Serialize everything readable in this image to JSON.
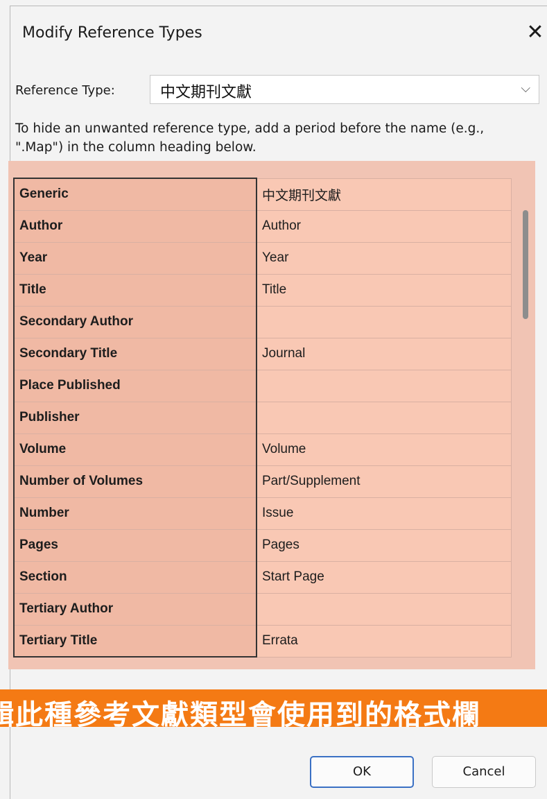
{
  "window": {
    "title": "Modify Reference Types",
    "close_glyph": "✕"
  },
  "reference_type": {
    "label": "Reference Type:",
    "selected": "中文期刊文獻",
    "chevron": "⌵"
  },
  "instructions": "To hide an unwanted reference type, add a period before the name (e.g., \".Map\") in the column heading below.",
  "field_grid": {
    "rows": [
      {
        "field": "Generic",
        "value": "中文期刊文獻"
      },
      {
        "field": "Author",
        "value": "Author"
      },
      {
        "field": "Year",
        "value": "Year"
      },
      {
        "field": "Title",
        "value": "Title"
      },
      {
        "field": "Secondary Author",
        "value": ""
      },
      {
        "field": "Secondary Title",
        "value": "Journal"
      },
      {
        "field": "Place Published",
        "value": ""
      },
      {
        "field": "Publisher",
        "value": ""
      },
      {
        "field": "Volume",
        "value": "Volume"
      },
      {
        "field": "Number of Volumes",
        "value": "Part/Supplement"
      },
      {
        "field": "Number",
        "value": "Issue"
      },
      {
        "field": "Pages",
        "value": "Pages"
      },
      {
        "field": "Section",
        "value": "Start Page"
      },
      {
        "field": "Tertiary Author",
        "value": ""
      },
      {
        "field": "Tertiary Title",
        "value": "Errata"
      }
    ]
  },
  "banner": {
    "text": "輯此種參考文獻類型會使用到的格式欄"
  },
  "buttons": {
    "ok": "OK",
    "cancel": "Cancel"
  },
  "colors": {
    "highlight_panel": "#f1c4b4",
    "banner": "#f47a14",
    "ok_border": "#3a70c4"
  }
}
